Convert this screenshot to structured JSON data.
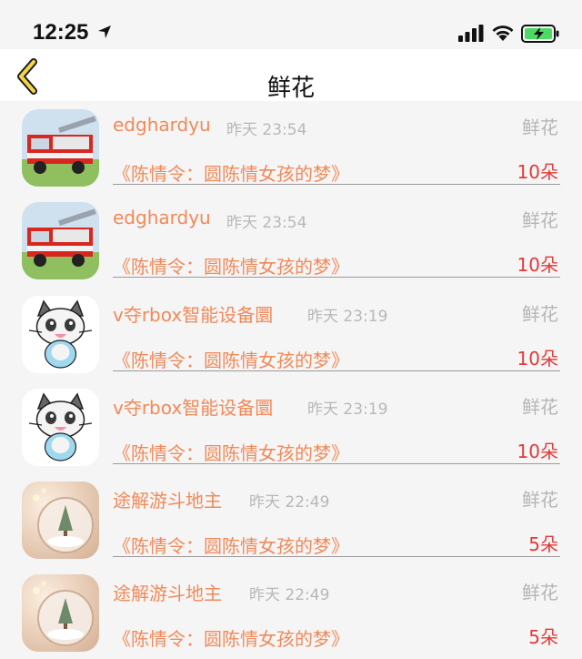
{
  "status_bar": {
    "time": "12:25"
  },
  "nav": {
    "title": "鲜花"
  },
  "colors": {
    "username": "#f08a5a",
    "amount": "#e23a3a",
    "muted": "#b5b5b5"
  },
  "rows": [
    {
      "avatar": "fire-truck-avatar",
      "username": "edghardyu",
      "time": "昨天 23:54",
      "gift": "鲜花",
      "book": "《陈情令：圆陈情女孩的梦》",
      "amount": "10朵"
    },
    {
      "avatar": "fire-truck-avatar",
      "username": "edghardyu",
      "time": "昨天 23:54",
      "gift": "鲜花",
      "book": "《陈情令：圆陈情女孩的梦》",
      "amount": "10朵"
    },
    {
      "avatar": "cat-avatar",
      "username": "v夺rbox智能设备圜",
      "time": "昨天 23:19",
      "gift": "鲜花",
      "book": "《陈情令：圆陈情女孩的梦》",
      "amount": "10朵"
    },
    {
      "avatar": "cat-avatar",
      "username": "v夺rbox智能设备圜",
      "time": "昨天 23:19",
      "gift": "鲜花",
      "book": "《陈情令：圆陈情女孩的梦》",
      "amount": "10朵"
    },
    {
      "avatar": "snow-globe-avatar",
      "username": "途解游斗地主",
      "time": "昨天 22:49",
      "gift": "鲜花",
      "book": "《陈情令：圆陈情女孩的梦》",
      "amount": "5朵"
    },
    {
      "avatar": "snow-globe-avatar",
      "username": "途解游斗地主",
      "time": "昨天 22:49",
      "gift": "鲜花",
      "book": "《陈情令：圆陈情女孩的梦》",
      "amount": "5朵"
    }
  ]
}
